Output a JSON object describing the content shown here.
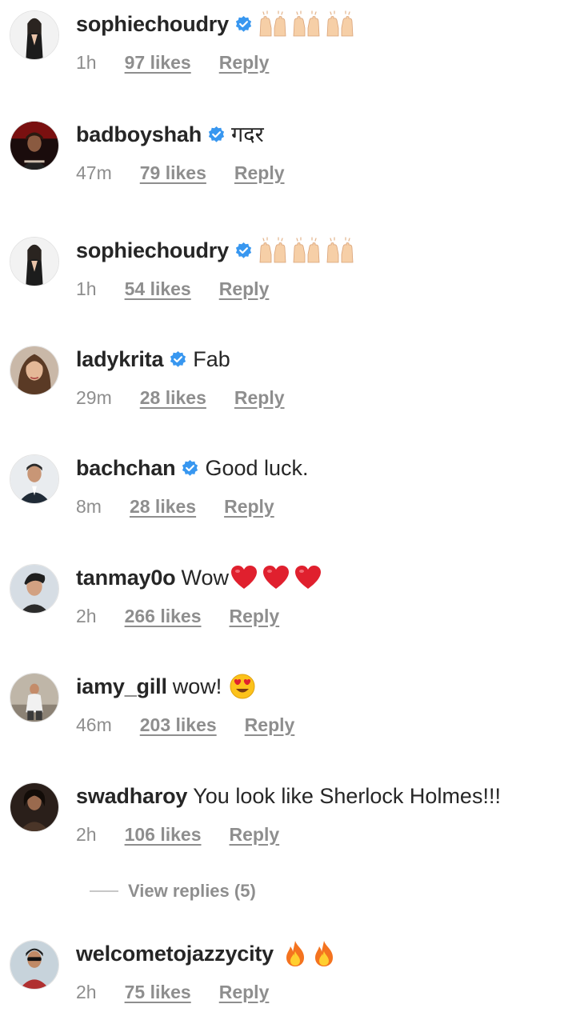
{
  "colors": {
    "text_primary": "#262626",
    "text_secondary": "#8e8e8e",
    "verified_blue": "#3897f0",
    "heart_red": "#e0202e"
  },
  "comments": [
    {
      "username": "sophiechoudry",
      "verified": true,
      "text": "",
      "emoji": [
        "raised-hands-icon",
        "raised-hands-icon",
        "raised-hands-icon"
      ],
      "time": "1h",
      "likes": "97 likes",
      "reply": "Reply"
    },
    {
      "username": "badboyshah",
      "verified": true,
      "text": "गदर",
      "emoji": [],
      "time": "47m",
      "likes": "79 likes",
      "reply": "Reply"
    },
    {
      "username": "sophiechoudry",
      "verified": true,
      "text": "",
      "emoji": [
        "raised-hands-icon",
        "raised-hands-icon",
        "raised-hands-icon"
      ],
      "time": "1h",
      "likes": "54 likes",
      "reply": "Reply"
    },
    {
      "username": "ladykrita",
      "verified": true,
      "text": "Fab",
      "emoji": [],
      "time": "29m",
      "likes": "28 likes",
      "reply": "Reply"
    },
    {
      "username": "bachchan",
      "verified": true,
      "text": "Good luck.",
      "emoji": [],
      "time": "8m",
      "likes": "28 likes",
      "reply": "Reply"
    },
    {
      "username": "tanmay0o",
      "verified": false,
      "text": "Wow",
      "emoji": [
        "red-heart-icon",
        "red-heart-icon",
        "red-heart-icon"
      ],
      "time": "2h",
      "likes": "266 likes",
      "reply": "Reply"
    },
    {
      "username": "iamy_gill",
      "verified": false,
      "text": "wow!",
      "emoji": [
        "heart-eyes-icon"
      ],
      "time": "46m",
      "likes": "203 likes",
      "reply": "Reply"
    },
    {
      "username": "swadharoy",
      "verified": false,
      "text": "You look like Sherlock Holmes!!!",
      "emoji": [],
      "time": "2h",
      "likes": "106 likes",
      "reply": "Reply"
    },
    {
      "username": "welcometojazzycity",
      "verified": false,
      "text": "",
      "emoji": [
        "fire-icon",
        "fire-icon"
      ],
      "time": "2h",
      "likes": "75 likes",
      "reply": "Reply"
    }
  ],
  "view_replies": "View replies (5)"
}
